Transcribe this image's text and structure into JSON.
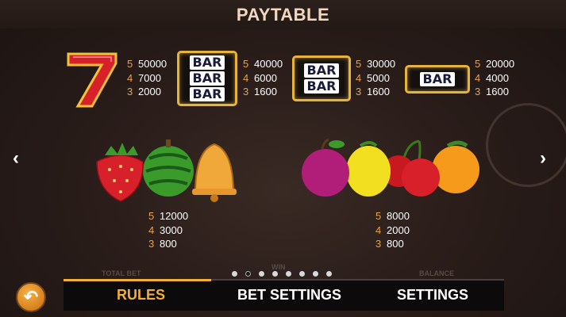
{
  "header": {
    "title": "PAYTABLE"
  },
  "symbols_top": [
    {
      "name": "seven",
      "pays": [
        {
          "n": "5",
          "v": "50000"
        },
        {
          "n": "4",
          "v": "7000"
        },
        {
          "n": "3",
          "v": "2000"
        }
      ]
    },
    {
      "name": "triple-bar",
      "lines": [
        "BAR",
        "BAR",
        "BAR"
      ],
      "pays": [
        {
          "n": "5",
          "v": "40000"
        },
        {
          "n": "4",
          "v": "6000"
        },
        {
          "n": "3",
          "v": "1600"
        }
      ]
    },
    {
      "name": "double-bar",
      "lines": [
        "BAR",
        "BAR"
      ],
      "pays": [
        {
          "n": "5",
          "v": "30000"
        },
        {
          "n": "4",
          "v": "5000"
        },
        {
          "n": "3",
          "v": "1600"
        }
      ]
    },
    {
      "name": "single-bar",
      "lines": [
        "BAR"
      ],
      "pays": [
        {
          "n": "5",
          "v": "20000"
        },
        {
          "n": "4",
          "v": "4000"
        },
        {
          "n": "3",
          "v": "1600"
        }
      ]
    }
  ],
  "groups_bottom": [
    {
      "name": "strawberry-watermelon-bell",
      "pays": [
        {
          "n": "5",
          "v": "12000"
        },
        {
          "n": "4",
          "v": "3000"
        },
        {
          "n": "3",
          "v": "800"
        }
      ]
    },
    {
      "name": "plum-lemon-cherry-orange",
      "pays": [
        {
          "n": "5",
          "v": "8000"
        },
        {
          "n": "4",
          "v": "2000"
        },
        {
          "n": "3",
          "v": "800"
        }
      ]
    }
  ],
  "pagination": {
    "total": 8,
    "active_index": 1
  },
  "background_labels": {
    "total_bet": "TOTAL BET",
    "win": "WIN",
    "balance": "BALANCE"
  },
  "nav": {
    "rules": "RULES",
    "bet_settings": "BET SETTINGS",
    "settings": "SETTINGS"
  },
  "icons": {
    "prev": "chevron-left-icon",
    "next": "chevron-right-icon",
    "back": "back-arrow-icon"
  },
  "colors": {
    "accent": "#f2b036",
    "payout_count": "#e8a24a",
    "bar_border": "#e6b43a"
  }
}
